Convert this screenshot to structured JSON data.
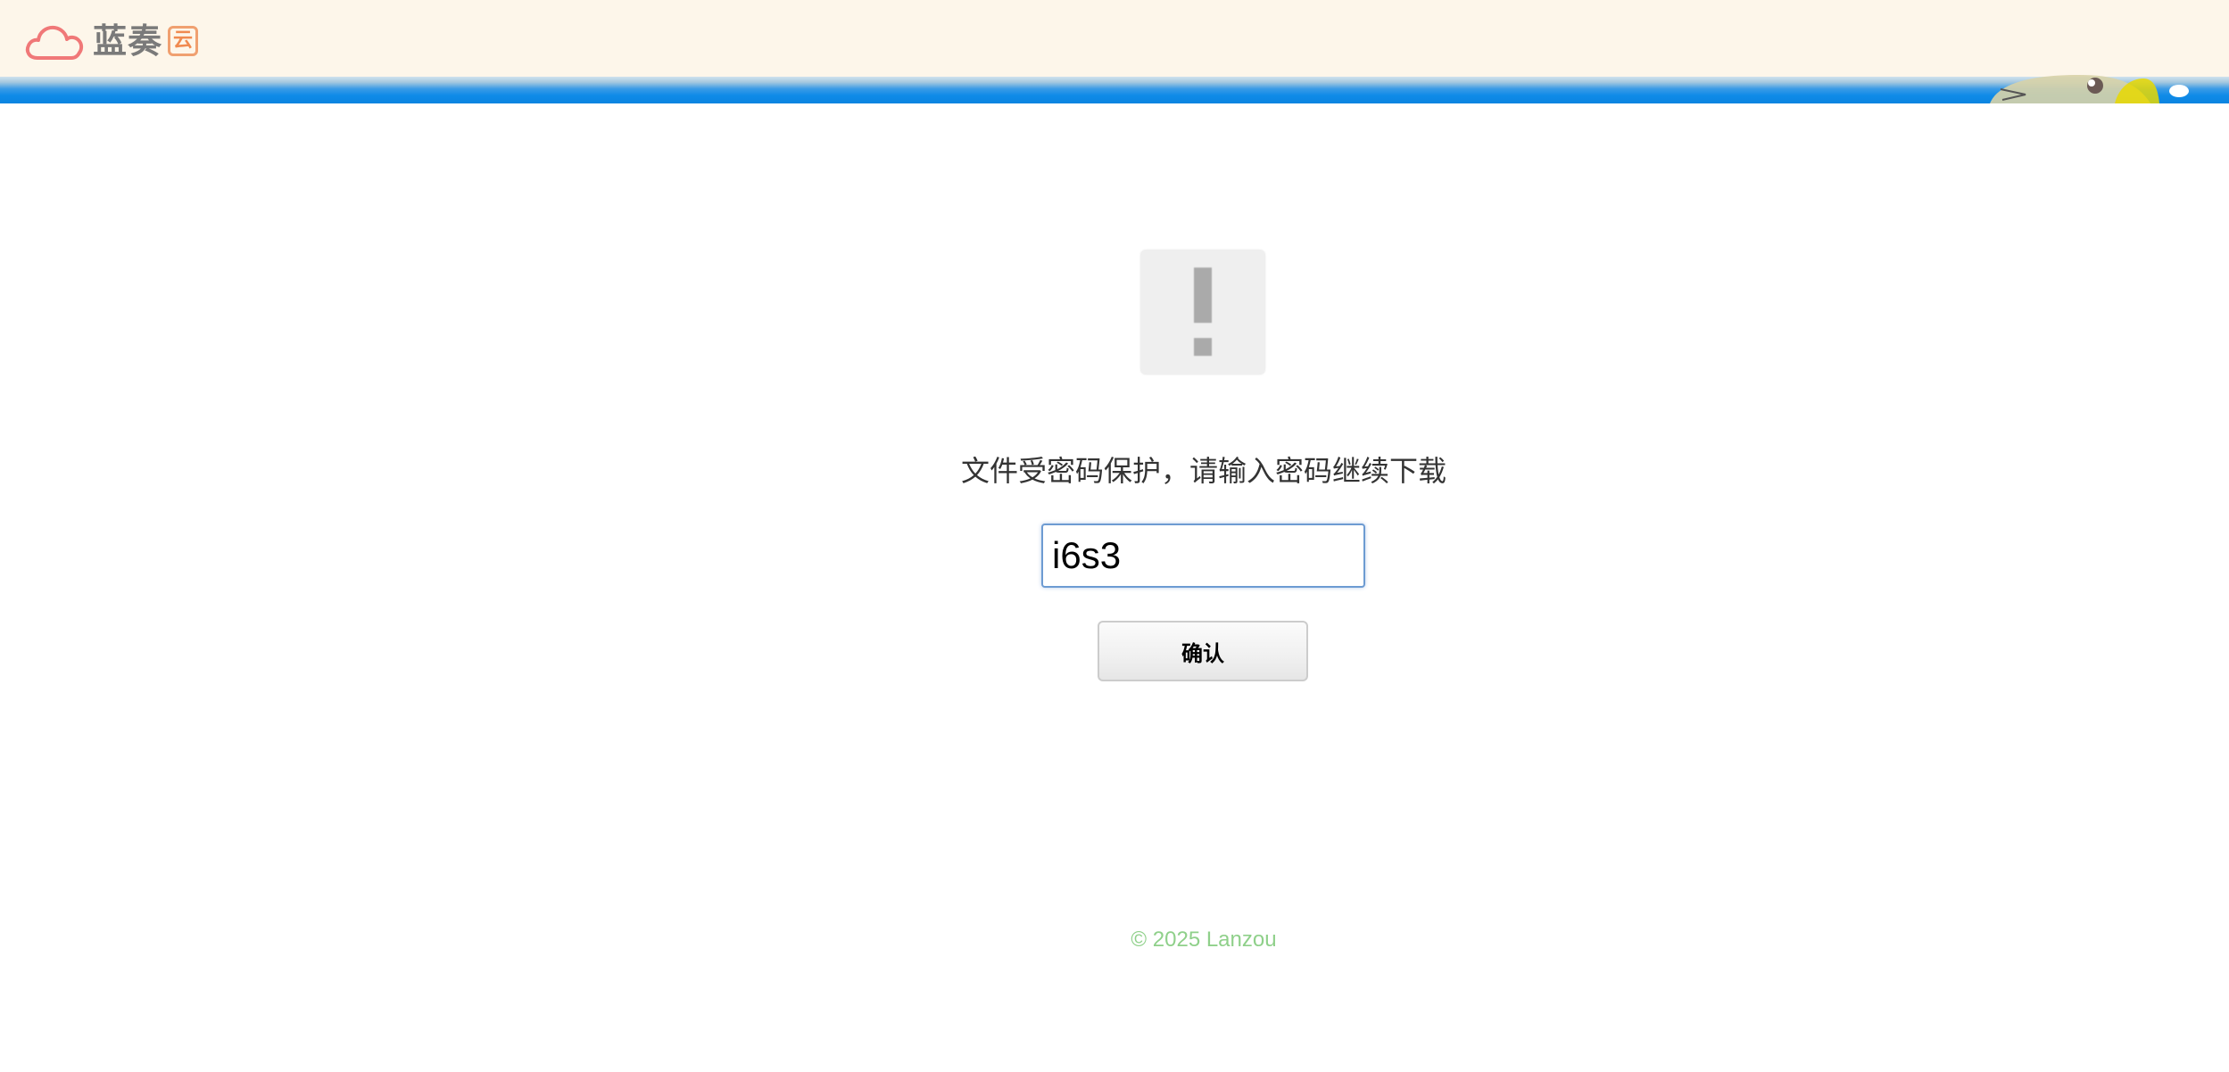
{
  "header": {
    "logo_text": "蓝奏",
    "logo_badge": "云",
    "brand_color": "#f07878",
    "stripe_color": "#0f8be8"
  },
  "main": {
    "alert_icon": "exclamation-icon",
    "message": "文件受密码保护，请输入密码继续下载",
    "password_value": "i6s3",
    "confirm_label": "确认"
  },
  "footer": {
    "copyright": "© 2025 Lanzou",
    "color": "#8fd08a"
  }
}
